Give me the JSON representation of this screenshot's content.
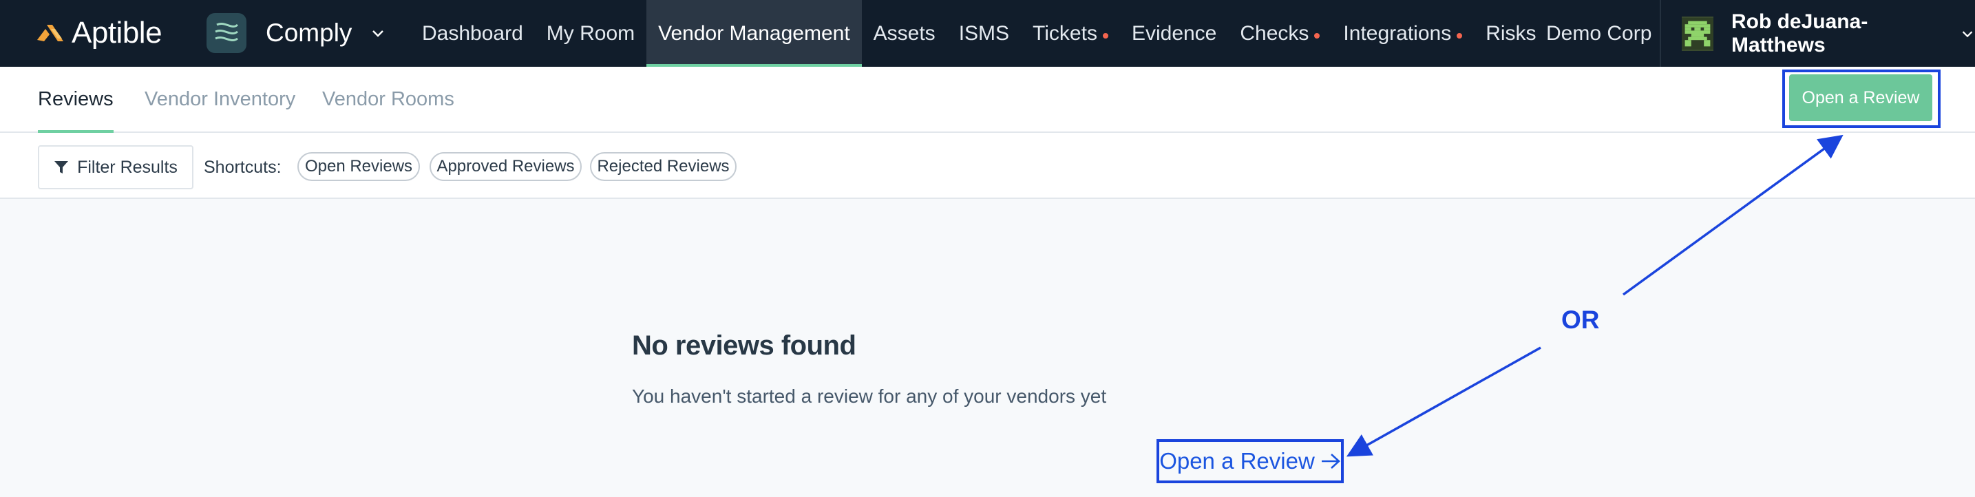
{
  "brand": {
    "name": "Aptible"
  },
  "product": {
    "name": "Comply"
  },
  "nav": {
    "items": [
      {
        "label": "Dashboard"
      },
      {
        "label": "My Room"
      },
      {
        "label": "Vendor Management",
        "active": true
      },
      {
        "label": "Assets"
      },
      {
        "label": "ISMS"
      },
      {
        "label": "Tickets",
        "dot": true
      },
      {
        "label": "Evidence"
      },
      {
        "label": "Checks",
        "dot": true
      },
      {
        "label": "Integrations",
        "dot": true
      },
      {
        "label": "Risks"
      }
    ]
  },
  "org": {
    "name": "Demo Corp"
  },
  "user": {
    "name": "Rob deJuana-Matthews"
  },
  "tabs": {
    "reviews": "Reviews",
    "inventory": "Vendor Inventory",
    "rooms": "Vendor Rooms"
  },
  "actions": {
    "open_review": "Open a Review"
  },
  "filters": {
    "button": "Filter Results",
    "shortcuts_label": "Shortcuts:",
    "chips": [
      "Open Reviews",
      "Approved Reviews",
      "Rejected Reviews"
    ]
  },
  "empty": {
    "title": "No reviews found",
    "subtitle": "You haven't started a review for any of your vendors yet",
    "link": "Open a Review"
  },
  "annotation": {
    "or": "OR"
  },
  "colors": {
    "nav_bg": "#111d2b",
    "accent_green": "#6cc79a",
    "annotation_blue": "#1a44dd",
    "link_blue": "#1b55e0",
    "dot_red": "#f5654f"
  },
  "icons": [
    "aptible-logo-icon",
    "comply-logo-icon",
    "chevron-down-icon",
    "filter-icon",
    "arrow-right-icon"
  ]
}
